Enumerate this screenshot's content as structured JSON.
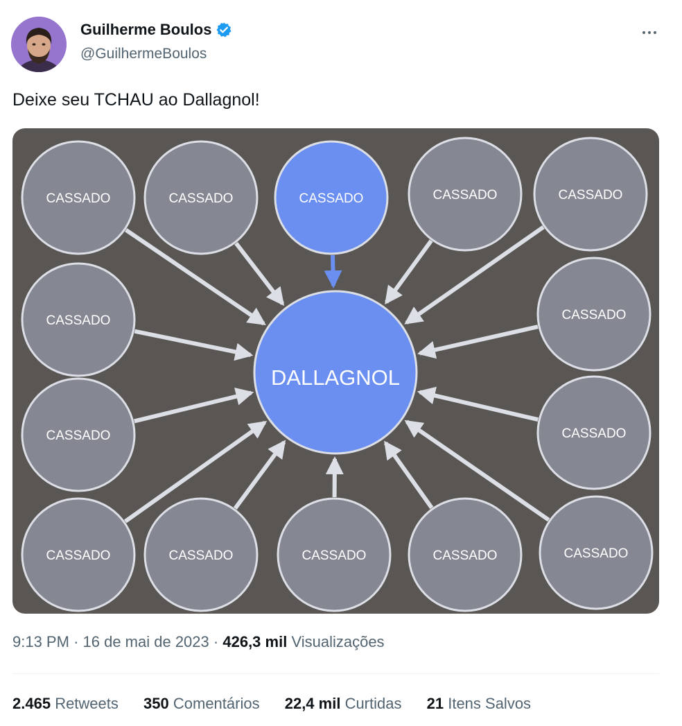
{
  "tweet": {
    "author": {
      "display_name": "Guilherme Boulos",
      "handle": "@GuilhermeBoulos",
      "verified": true,
      "avatar_icon": "avatar-portrait"
    },
    "more_icon": "more-horizontal-icon",
    "text": "Deixe seu TCHAU ao Dallagnol!",
    "image": {
      "center_label": "DALLAGNOL",
      "node_label": "CASSADO",
      "outer_node_count": 14,
      "highlighted_node": "top-center",
      "colors": {
        "background": "#5a5654",
        "gray_node": "#858893",
        "blue_node": "#6a8ff0",
        "outline": "#dcdfe6"
      }
    },
    "time": "9:13 PM",
    "date": "16 de mai de 2023",
    "views_count": "426,3 mil",
    "views_label": "Visualizações",
    "separator": "·",
    "stats": [
      {
        "count": "2.465",
        "label": "Retweets"
      },
      {
        "count": "350",
        "label": "Comentários"
      },
      {
        "count": "22,4 mil",
        "label": "Curtidas"
      },
      {
        "count": "21",
        "label": "Itens Salvos"
      }
    ],
    "colors": {
      "verified_badge": "#1d9bf0",
      "secondary_text": "#536471",
      "primary_text": "#0f1419"
    }
  }
}
